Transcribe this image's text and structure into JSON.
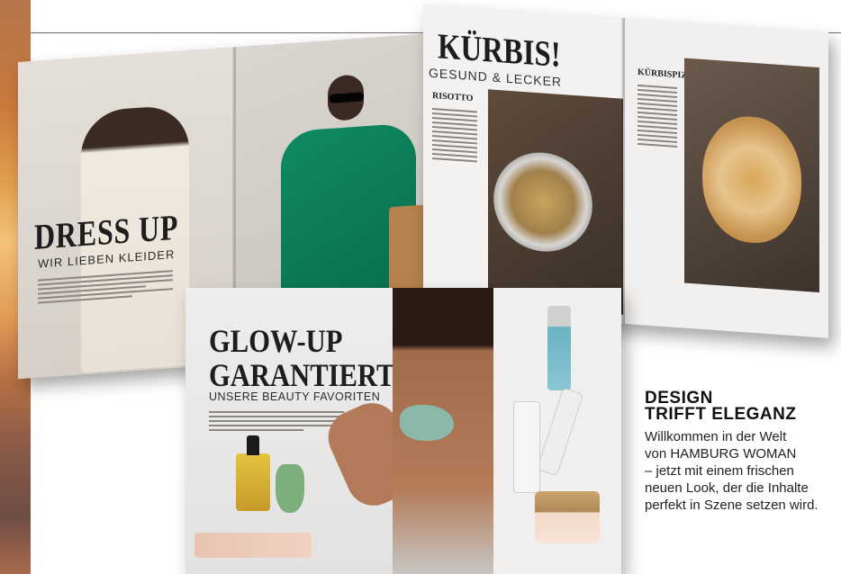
{
  "spread_1": {
    "title": "DRESS UP",
    "subtitle": "WIR LIEBEN KLEIDER"
  },
  "spread_2": {
    "title": "KÜRBIS!",
    "subtitle": "GESUND & LECKER",
    "recipe_left": "RISOTTO",
    "recipe_right": "KÜRBISPIZZA"
  },
  "spread_3": {
    "title_line1": "GLOW-UP",
    "title_line2": "GARANTIERT",
    "subtitle": "UNSERE BEAUTY FAVORITEN"
  },
  "promo": {
    "headline_line1": "DESIGN",
    "headline_line2": "TRIFFT ELEGANZ",
    "body_line1": "Willkommen in der Welt",
    "body_line2": "von HAMBURG WOMAN",
    "body_line3": "– jetzt mit einem frischen",
    "body_line4": "neuen Look, der die Inhalte",
    "body_line5": "perfekt in Szene setzen wird."
  },
  "colors": {
    "accent_green_dress": "#0f8a62",
    "headline_text": "#111111",
    "rule_gray": "#6d6d6d"
  }
}
